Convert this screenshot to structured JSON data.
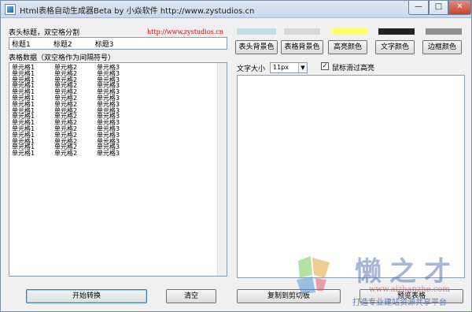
{
  "window": {
    "title": "Html表格自动生成器Beta   by 小焱软件 http://www.zystudios.cn",
    "minimize": "—",
    "maximize": "□",
    "close": "✕"
  },
  "left": {
    "header_label": "表头标题，双空格分割",
    "site_link": "http://www.zystudios.cn",
    "header_values": [
      "标题1",
      "标题2",
      "标题3"
    ],
    "data_label": "表格数据（双空格作为间隔符号）",
    "rows": [
      [
        "单元格1",
        "单元格2",
        "单元格3"
      ],
      [
        "单元格1",
        "单元格2",
        "单元格3"
      ],
      [
        "单元格1",
        "单元格2",
        "单元格3"
      ],
      [
        "单元格1",
        "单元格2",
        "单元格3"
      ],
      [
        "单元格1",
        "单元格2",
        "单元格3"
      ],
      [
        "单元格1",
        "单元格2",
        "单元格3"
      ],
      [
        "单元格1",
        "单元格2",
        "单元格3"
      ],
      [
        "单元格1",
        "单元格2",
        "单元格3"
      ],
      [
        "单元格1",
        "单元格2",
        "单元格3"
      ],
      [
        "单元格1",
        "单元格2",
        "单元格3"
      ],
      [
        "单元格1",
        "单元格2",
        "单元格3"
      ],
      [
        "单元格1",
        "单元格2",
        "单元格3"
      ],
      [
        "单元格1",
        "单元格2",
        "单元格3"
      ],
      [
        "单元格1",
        "单元格2",
        "单元格3"
      ],
      [
        "单元格1",
        "单元格2",
        "单元格3"
      ]
    ]
  },
  "colors": {
    "header_bg": "#c1dde6",
    "table_bg": "#d9d9d9",
    "highlight": "#ffff66",
    "text": "#222222",
    "border": "#8e8e8e"
  },
  "color_buttons": {
    "header_bg": "表头背景色",
    "table_bg": "表格背景色",
    "highlight": "高亮颜色",
    "text": "文字颜色",
    "border": "边框颜色"
  },
  "options": {
    "font_size_label": "文字大小",
    "font_size_value": "11px",
    "hover_label": "鼠标滑过高亮",
    "hover_checked": "✓"
  },
  "actions": {
    "convert": "开始转换",
    "clear": "清空",
    "copy": "复制到剪切板",
    "preview": "预览表格"
  },
  "watermark": {
    "name": "懒之才",
    "url": "www.aizhanzhe.com",
    "slogan": "打造专业建站资源共享平台"
  }
}
